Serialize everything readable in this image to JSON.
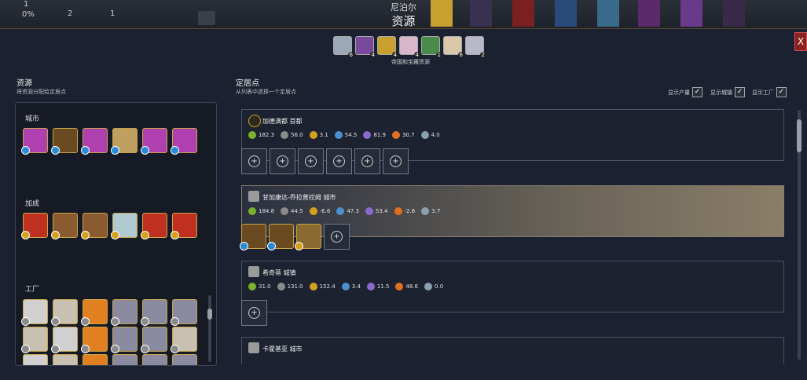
{
  "topbar": {
    "stat1_val": "1",
    "stat1_pct": "0%",
    "stat2_val": "2",
    "stat3_val": "1",
    "title_sub": "尼泊尔",
    "title_main": "资源",
    "close_label": "X"
  },
  "top_resources": {
    "label": "帝国和宝藏资源",
    "items": [
      {
        "icon": "silver-coin-icon",
        "count": "6",
        "color": "#9aa8b8"
      },
      {
        "icon": "purple-cloth-icon",
        "count": "4",
        "color": "#7a4a9a"
      },
      {
        "icon": "gold-bars-icon",
        "count": "4",
        "color": "#c9a030"
      },
      {
        "icon": "pearls-icon",
        "count": "4",
        "color": "#d8b8c8"
      },
      {
        "icon": "jade-icon",
        "count": "1",
        "color": "#4a8a4a"
      },
      {
        "icon": "ivory-icon",
        "count": "6",
        "color": "#d8c8a8"
      },
      {
        "icon": "silver-icon",
        "count": "2",
        "color": "#b8b8c8"
      }
    ]
  },
  "left": {
    "title": "资源",
    "subtitle": "将资源分配给定居点",
    "groups": [
      {
        "label": "城市",
        "icons": [
          {
            "name": "silk-icon",
            "color": "#b040b0",
            "dot": "blue"
          },
          {
            "name": "tobacco-pipe-icon",
            "color": "#6a4a20",
            "dot": "blue"
          },
          {
            "name": "silk-icon",
            "color": "#b040b0",
            "dot": "blue"
          },
          {
            "name": "spice-icon",
            "color": "#c0a060",
            "dot": "blue"
          },
          {
            "name": "silk-icon",
            "color": "#b040b0",
            "dot": "blue"
          },
          {
            "name": "silk-icon",
            "color": "#b040b0",
            "dot": "blue"
          }
        ]
      },
      {
        "label": "加成",
        "icons": [
          {
            "name": "red-spice-icon",
            "color": "#c03020",
            "dot": "gold"
          },
          {
            "name": "horse-icon",
            "color": "#8a5a30",
            "dot": "gold"
          },
          {
            "name": "horse-icon",
            "color": "#8a5a30",
            "dot": "gold"
          },
          {
            "name": "salt-icon",
            "color": "#b0c8d0",
            "dot": "gold"
          },
          {
            "name": "red-spice-icon",
            "color": "#c03020",
            "dot": "gold"
          },
          {
            "name": "red-spice-icon",
            "color": "#c03020",
            "dot": "gold"
          }
        ]
      },
      {
        "label": "工厂",
        "icons": [
          {
            "name": "cotton-icon",
            "color": "#d0d0d0",
            "dot": "grey"
          },
          {
            "name": "tea-icon",
            "color": "#c8c0b0",
            "dot": "grey"
          },
          {
            "name": "orange-icon",
            "color": "#e08020",
            "dot": "grey"
          },
          {
            "name": "flowers-icon",
            "color": "#8a8aa0",
            "dot": "grey"
          },
          {
            "name": "flowers-icon",
            "color": "#8a8aa0",
            "dot": "grey"
          },
          {
            "name": "flowers-icon",
            "color": "#8a8aa0",
            "dot": "grey"
          },
          {
            "name": "tea-icon",
            "color": "#c8c0b0",
            "dot": "grey"
          },
          {
            "name": "cotton-icon",
            "color": "#d0d0d0",
            "dot": "grey"
          },
          {
            "name": "orange-icon",
            "color": "#e08020",
            "dot": "grey"
          },
          {
            "name": "flowers-icon",
            "color": "#8a8aa0",
            "dot": "grey"
          },
          {
            "name": "flowers-icon",
            "color": "#8a8aa0",
            "dot": "grey"
          },
          {
            "name": "tea-icon",
            "color": "#c8c0b0",
            "dot": "grey"
          }
        ]
      }
    ]
  },
  "right": {
    "title": "定居点",
    "subtitle": "从列表中选择一个定居点",
    "checks": [
      {
        "label": "显示产量",
        "checked": "✓"
      },
      {
        "label": "显示城镇",
        "checked": "✓"
      },
      {
        "label": "显示工厂",
        "checked": "✓"
      }
    ],
    "settlements": [
      {
        "name": "加德满都 首都",
        "stats": [
          "182.3",
          "56.0",
          "3.1",
          "54.5",
          "81.9",
          "30.7",
          "4.0"
        ]
      },
      {
        "name": "甘加康达-乔拉普拉姆 城市",
        "stats": [
          "184.8",
          "44.5",
          "-6.6",
          "47.3",
          "53.4",
          "-2.6",
          "3.7"
        ]
      },
      {
        "name": "希奇蒂 城镇",
        "stats": [
          "31.0",
          "131.0",
          "152.4",
          "3.4",
          "11.5",
          "48.6",
          "0.0"
        ]
      },
      {
        "name": "卡霍基亚 城市",
        "stats": []
      }
    ],
    "stat_icons": [
      "food-icon",
      "hammer-icon",
      "gold-icon",
      "science-icon",
      "culture-icon",
      "happiness-icon",
      "influence-icon"
    ]
  }
}
